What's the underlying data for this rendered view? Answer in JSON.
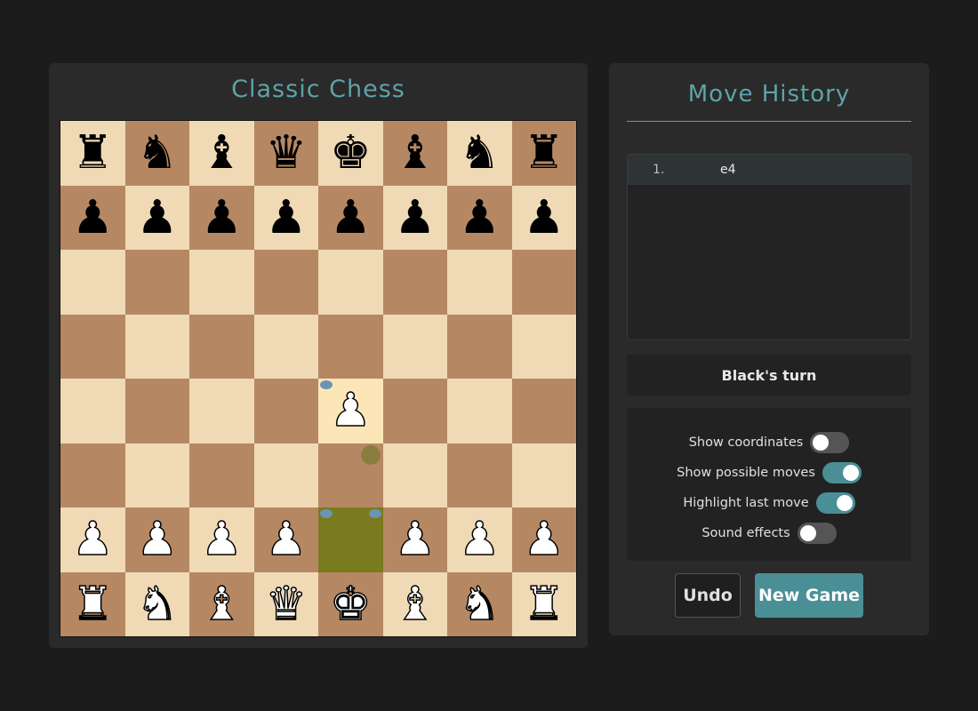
{
  "board_panel": {
    "title": "Classic Chess"
  },
  "board": {
    "rows": [
      [
        "br",
        "bn",
        "bb",
        "bq",
        "bk",
        "bb",
        "bn",
        "br"
      ],
      [
        "bp",
        "bp",
        "bp",
        "bp",
        "bp",
        "bp",
        "bp",
        "bp"
      ],
      [
        "",
        "",
        "",
        "",
        "",
        "",
        "",
        ""
      ],
      [
        "",
        "",
        "",
        "",
        "",
        "",
        "",
        ""
      ],
      [
        "",
        "",
        "",
        "",
        "wp",
        "",
        "",
        ""
      ],
      [
        "",
        "",
        "",
        "",
        "",
        "",
        "",
        ""
      ],
      [
        "wp",
        "wp",
        "wp",
        "wp",
        "",
        "wp",
        "wp",
        "wp"
      ],
      [
        "wr",
        "wn",
        "wb",
        "wq",
        "wk",
        "wb",
        "wn",
        "wr"
      ]
    ],
    "last_move_from": "e2",
    "last_move_to": "e4"
  },
  "side_panel": {
    "title": "Move History",
    "moves": [
      {
        "number": "1.",
        "white": "e4",
        "black": ""
      }
    ],
    "turn_status": "Black's turn",
    "settings": [
      {
        "label": "Show coordinates",
        "on": false
      },
      {
        "label": "Show possible moves",
        "on": true
      },
      {
        "label": "Highlight last move",
        "on": true
      },
      {
        "label": "Sound effects",
        "on": false
      }
    ],
    "undo_label": "Undo",
    "new_game_label": "New Game"
  },
  "colors": {
    "accent": "#4a8f96",
    "light_square": "#f0dab5",
    "dark_square": "#b58863",
    "last_move": "#7a7a1e"
  }
}
